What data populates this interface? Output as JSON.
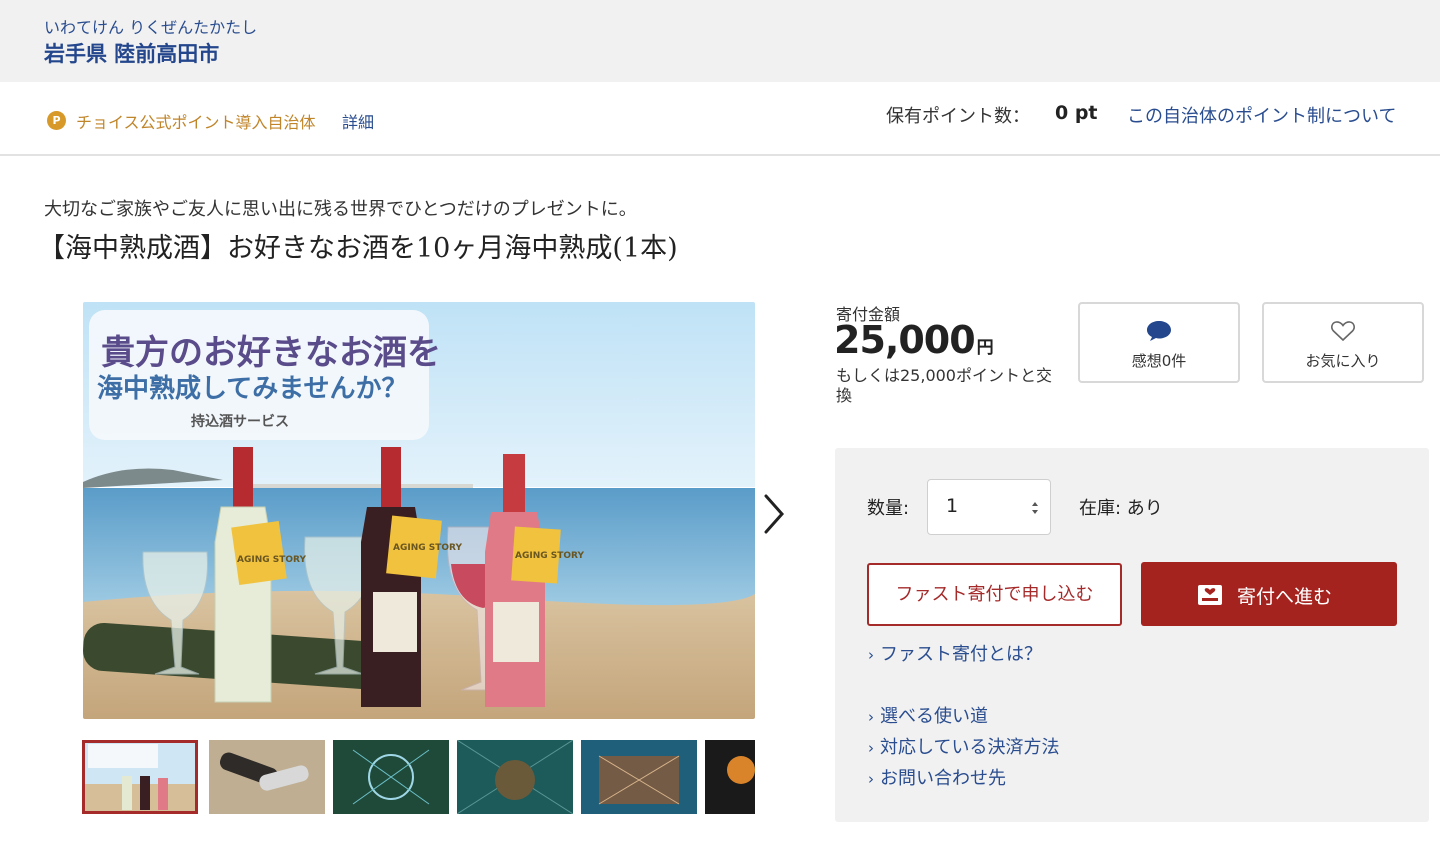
{
  "municipality": {
    "kana": "いわてけん りくぜんたかたし",
    "name": "岩手県 陸前高田市"
  },
  "point_bar": {
    "badge": "P",
    "label": "チョイス公式ポイント導入自治体",
    "detail_link": "詳細",
    "held_label": "保有ポイント数：",
    "held_value": "0 pt",
    "about_link": "この自治体のポイント制について"
  },
  "product": {
    "subtitle": "大切なご家族やご友人に思い出に残る世界でひとつだけのプレゼントに。",
    "title": "【海中熟成酒】お好きなお酒を10ヶ月海中熟成(1本)"
  },
  "gallery": {
    "banner_line1": "貴方のお好きなお酒を",
    "banner_line2": "海中熟成してみませんか？",
    "banner_line3": "持込酒サービス",
    "label_text": "AGING STORY",
    "next_icon": "chevron-right-icon",
    "thumbnail_count": 6,
    "active_thumbnail": 1
  },
  "price": {
    "label": "寄付金額",
    "value": "25,000",
    "unit": "円",
    "alt": "もしくは25,000ポイントと交換"
  },
  "actions": {
    "review_label": "感想0件",
    "review_icon": "speech-bubble-icon",
    "favorite_label": "お気に入り",
    "favorite_icon": "heart-icon"
  },
  "order": {
    "qty_label": "数量:",
    "qty_value": "1",
    "stock_label": "在庫: あり",
    "fast_button": "ファスト寄付で申し込む",
    "donate_button": "寄付へ進む",
    "donate_icon": "gift-box-icon",
    "fast_help_link": "ファスト寄付とは？",
    "links": [
      "選べる使い道",
      "対応している決済方法",
      "お問い合わせ先"
    ]
  },
  "colors": {
    "brand_blue": "#2a4d8f",
    "accent_red": "#a5231f",
    "point_gold": "#d79a2a"
  }
}
